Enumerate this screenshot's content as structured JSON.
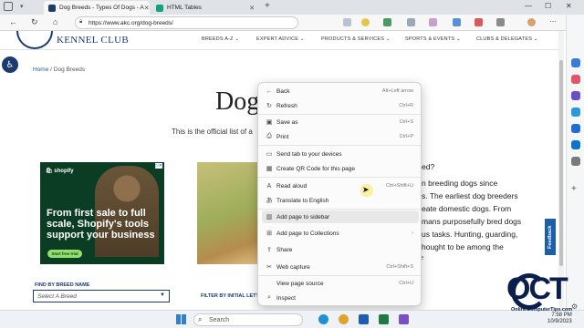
{
  "browser": {
    "tabs": [
      {
        "title": "Dog Breeds - Types Of Dogs - A"
      },
      {
        "title": "HTML Tables"
      }
    ],
    "new_tab": "+",
    "url": "https://www.akc.org/dog-breeds/",
    "window_controls": {
      "minimize": "—",
      "maximize": "☐",
      "close": "✕"
    }
  },
  "site": {
    "logo_text": "KENNEL CLUB",
    "nav": [
      "BREEDS A-Z ⌄",
      "EXPERT ADVICE ⌄",
      "PRODUCTS & SERVICES ⌄",
      "SPORTS & EVENTS ⌄",
      "CLUBS & DELEGATES ⌄"
    ],
    "breadcrumb": {
      "home": "Home",
      "separator": "/",
      "current": "Dog Breeds"
    },
    "page_title": "Dog",
    "intro": "This is the official list of a",
    "right_text": [
      "ed?",
      "n breeding dogs since",
      "s. The earliest dog breeders",
      "eate domestic dogs. From",
      "mans purposefully bred dogs",
      "us tasks. Hunting, guarding,",
      "hought to be among the"
    ],
    "right_link": "re",
    "find_label": "FIND BY BREED NAME",
    "breed_placeholder": "Select A Breed",
    "filter_label": "FILTER BY INITIAL LETT",
    "feedback": "Feedback"
  },
  "ad": {
    "brand": "shopify",
    "headline": "From first sale to full scale, Shopify's tools support your business",
    "cta": "Start free trial",
    "choices": "▷✕"
  },
  "context_menu": {
    "items": [
      {
        "icon": "←",
        "label": "Back",
        "shortcut": "Alt+Left arrow"
      },
      {
        "icon": "↻",
        "label": "Refresh",
        "shortcut": "Ctrl+R"
      },
      {
        "icon": "▣",
        "label": "Save as",
        "shortcut": "Ctrl+S"
      },
      {
        "icon": "⎙",
        "label": "Print",
        "shortcut": "Ctrl+P"
      },
      {
        "icon": "▭",
        "label": "Send tab to your devices",
        "shortcut": ""
      },
      {
        "icon": "▦",
        "label": "Create QR Code for this page",
        "shortcut": ""
      },
      {
        "icon": "A",
        "label": "Read aloud",
        "shortcut": "Ctrl+Shift+U"
      },
      {
        "icon": "あ",
        "label": "Translate to English",
        "shortcut": ""
      },
      {
        "icon": "▥",
        "label": "Add page to sidebar",
        "shortcut": ""
      },
      {
        "icon": "⊞",
        "label": "Add page to Collections",
        "shortcut": "›"
      },
      {
        "icon": "⇪",
        "label": "Share",
        "shortcut": ""
      },
      {
        "icon": "✂",
        "label": "Web capture",
        "shortcut": "Ctrl+Shift+S"
      },
      {
        "icon": "",
        "label": "View page source",
        "shortcut": "Ctrl+U"
      },
      {
        "icon": "⌕",
        "label": "Inspect",
        "shortcut": ""
      }
    ]
  },
  "taskbar": {
    "search": "Search",
    "time": "7:58 PM",
    "date": "10/9/2023"
  },
  "watermark": {
    "logo": "OCT",
    "caption": "OnlineComputerTips.com"
  }
}
